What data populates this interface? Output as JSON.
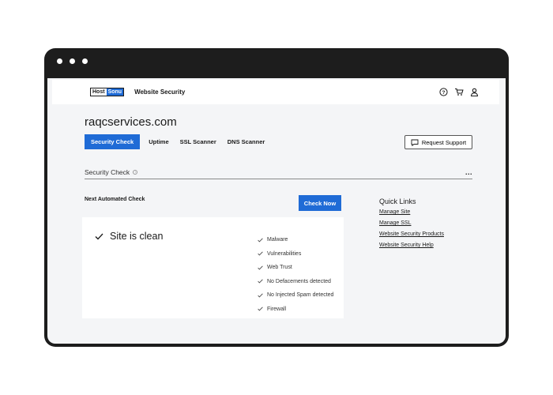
{
  "header": {
    "logo_host": "Host",
    "logo_sonu": "Sonu",
    "product": "Website Security",
    "icons": [
      "help-icon",
      "cart-icon",
      "user-icon"
    ]
  },
  "site": {
    "domain": "raqcservices.com"
  },
  "tabs": [
    {
      "label": "Security Check",
      "active": true
    },
    {
      "label": "Uptime",
      "active": false
    },
    {
      "label": "SSL Scanner",
      "active": false
    },
    {
      "label": "DNS Scanner",
      "active": false
    }
  ],
  "request_support": {
    "label": "Request Support",
    "icon": "chat-icon"
  },
  "section": {
    "title": "Security Check",
    "more": "..."
  },
  "scan": {
    "next_label": "Next Automated Check",
    "check_now": "Check Now",
    "status": "Site is clean",
    "checks": [
      "Malware",
      "Vulnerabilities",
      "Web Trust",
      "No Defacements detected",
      "No Injected Spam detected",
      "Firewall"
    ]
  },
  "quick_links": {
    "title": "Quick Links",
    "links": [
      "Manage Site",
      "Manage SSL",
      "Website Security Products",
      "Website Security Help"
    ]
  },
  "colors": {
    "accent": "#1f6bd6",
    "frame": "#1d1d1d",
    "content_bg": "#f4f5f7"
  }
}
